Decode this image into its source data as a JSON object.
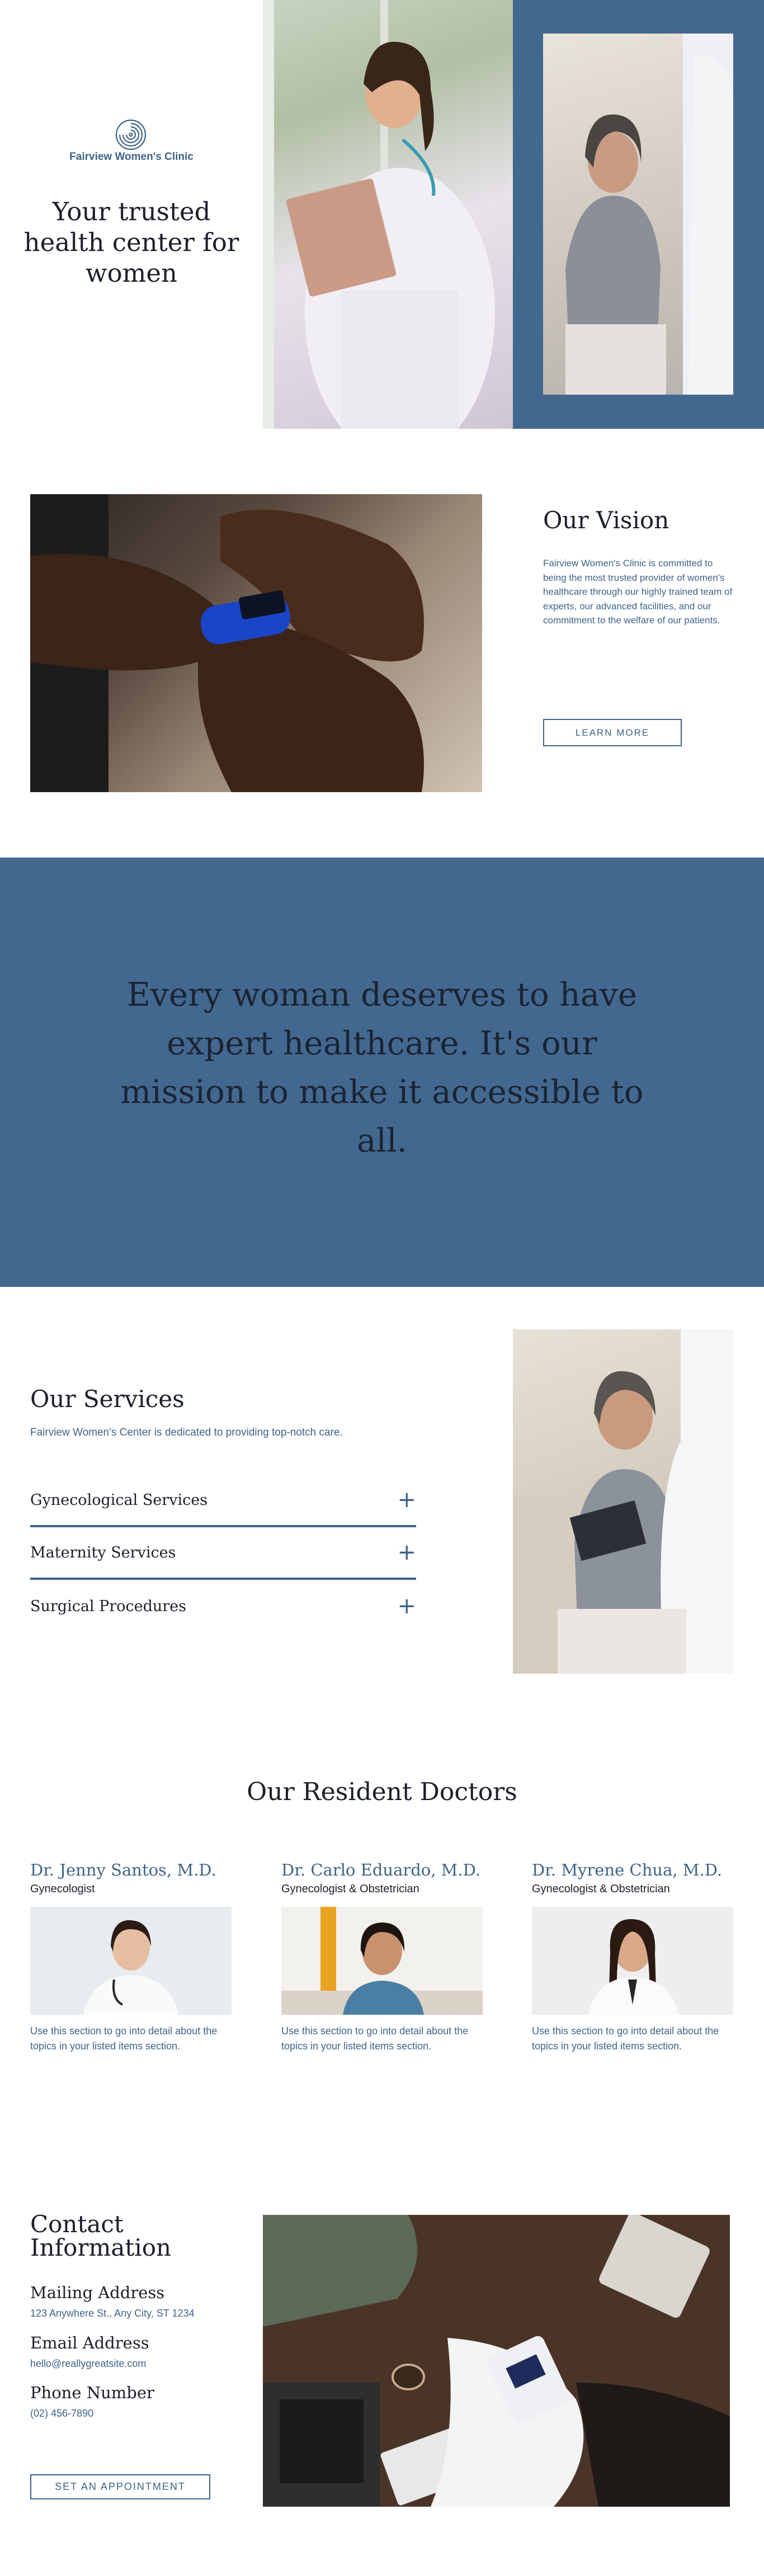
{
  "brand": {
    "name": "Fairview Women's Clinic",
    "accent_color": "#3e6387",
    "band_color": "#436890",
    "logo_icon": "fingerprint-spiral-icon"
  },
  "hero": {
    "title": "Your trusted health center for women",
    "photo_1": "doctor-with-clipboard-photo",
    "photo_2": "patient-consultation-photo"
  },
  "vision": {
    "title": "Our Vision",
    "body": "Fairview Women's Clinic is committed to being the most trusted provider of women's healthcare through our highly trained team of experts, our advanced facilities, and our commitment to the welfare of our patients.",
    "button_label": "LEARN MORE",
    "photo": "pulse-oximeter-photo"
  },
  "mission": {
    "text": "Every woman deserves to have expert healthcare. It's our mission to make it accessible to all."
  },
  "services": {
    "title": "Our Services",
    "subtitle": "Fairview Women's Center is dedicated to providing top-notch care.",
    "items": [
      {
        "label": "Gynecological Services",
        "icon": "plus-icon"
      },
      {
        "label": "Maternity Services",
        "icon": "plus-icon"
      },
      {
        "label": "Surgical Procedures",
        "icon": "plus-icon"
      }
    ],
    "photo": "patient-with-doctor-photo"
  },
  "doctors": {
    "title": "Our Resident Doctors",
    "items": [
      {
        "name": "Dr. Jenny Santos, M.D.",
        "role": "Gynecologist",
        "desc": "Use this section to go into detail about the topics in your listed items section."
      },
      {
        "name": "Dr. Carlo Eduardo, M.D.",
        "role": "Gynecologist & Obstetrician",
        "desc": "Use this section to go into detail about the topics in your listed items section."
      },
      {
        "name": "Dr. Myrene Chua, M.D.",
        "role": "Gynecologist & Obstetrician",
        "desc": "Use this section to go into detail about the topics in your listed items section."
      }
    ]
  },
  "contact": {
    "title": "Contact Information",
    "mailing_label": "Mailing Address",
    "mailing_value": "123 Anywhere St., Any City, ST 1234",
    "email_label": "Email Address",
    "email_value": "hello@reallygreatsite.com",
    "phone_label": "Phone Number",
    "phone_value": "(02) 456-7890",
    "button_label": "SET AN APPOINTMENT",
    "photo": "blood-pressure-check-photo"
  }
}
